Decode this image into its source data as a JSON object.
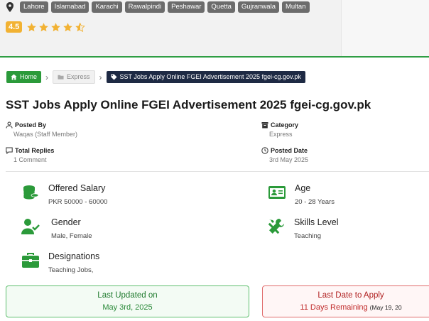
{
  "cities": [
    "Lahore",
    "Islamabad",
    "Karachi",
    "Rawalpindi",
    "Peshawar",
    "Quetta",
    "Gujranwala",
    "Multan"
  ],
  "rating": {
    "score": "4.5",
    "stars": 4.5
  },
  "breadcrumb": {
    "home": "Home",
    "category": "Express",
    "current": "SST Jobs Apply Online FGEI Advertisement 2025 fgei-cg.gov.pk"
  },
  "title": "SST Jobs Apply Online FGEI Advertisement 2025 fgei-cg.gov.pk",
  "meta": {
    "posted_by_label": "Posted By",
    "posted_by_value": "Waqas (Staff Member)",
    "category_label": "Category",
    "category_value": "Express",
    "replies_label": "Total Replies",
    "replies_value": "1 Comment",
    "posted_date_label": "Posted Date",
    "posted_date_value": "3rd May 2025"
  },
  "details": {
    "salary_label": "Offered Salary",
    "salary_value": "PKR 50000 - 60000",
    "age_label": "Age",
    "age_value": "20 - 28 Years",
    "gender_label": "Gender",
    "gender_value": "Male, Female",
    "skills_label": "Skills Level",
    "skills_value": "Teaching",
    "designations_label": "Designations",
    "designations_value": "Teaching Jobs,"
  },
  "updated": {
    "label": "Last Updated on",
    "value": "May 3rd, 2025"
  },
  "deadline": {
    "label": "Last Date to Apply",
    "value": "11 Days Remaining",
    "date": "(May 19, 20"
  },
  "colors": {
    "green": "#2b9a3a",
    "navy": "#1e2a44",
    "star": "#f2b233",
    "red": "#c02a2a"
  }
}
